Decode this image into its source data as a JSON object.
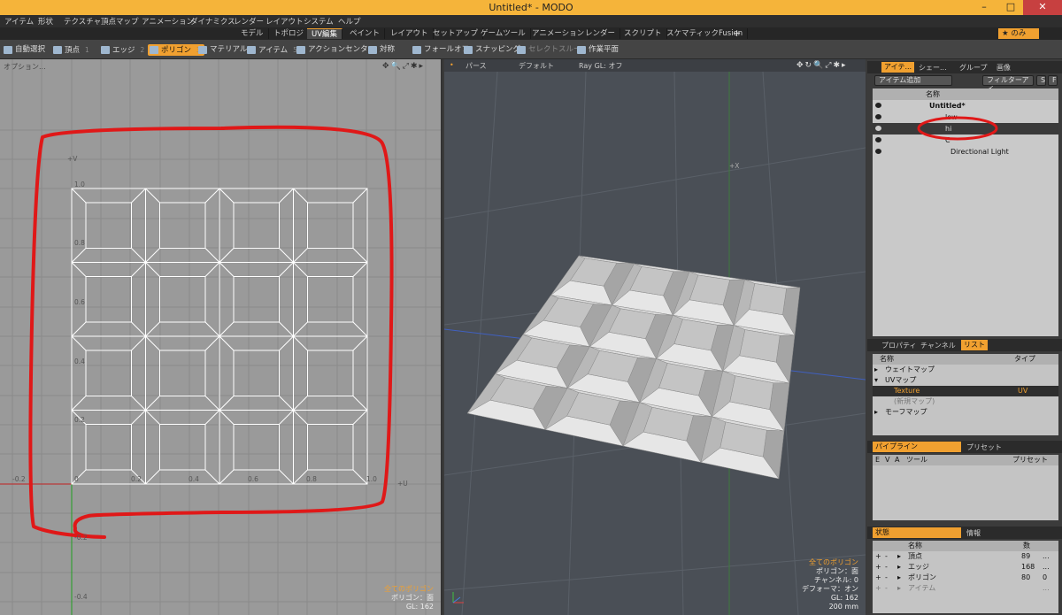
{
  "window": {
    "title": "Untitled* - MODO"
  },
  "menu": [
    "アイテム",
    "形状",
    "テクスチャ",
    "頂点マップ",
    "アニメーション",
    "ダイナミクス",
    "レンダー",
    "レイアウト",
    "システム",
    "ヘルプ"
  ],
  "tabs": [
    "モデル",
    "トポロジ",
    "UV編集",
    "ペイント",
    "レイアウト",
    "セットアップ",
    "ゲームツール",
    "アニメーション",
    "レンダー",
    "スクリプト",
    "スケマティックFusion"
  ],
  "active_tab": "UV編集",
  "tab_plus": "+",
  "layout_preset": "★ のみ",
  "toolbar": {
    "items": [
      {
        "label": "自動選択",
        "num": ""
      },
      {
        "label": "頂点",
        "num": "1"
      },
      {
        "label": "エッジ",
        "num": "2"
      },
      {
        "label": "ポリゴン",
        "num": "3"
      },
      {
        "label": "マテリアル",
        "num": ""
      },
      {
        "label": "アイテム",
        "num": "5"
      },
      {
        "label": "アクションセンター",
        "num": ""
      },
      {
        "label": "対称",
        "num": ""
      },
      {
        "label": "フォールオフ",
        "num": ""
      },
      {
        "label": "スナッピング",
        "num": ""
      },
      {
        "label": "セレクトスルー",
        "num": ""
      },
      {
        "label": "作業平面",
        "num": ""
      }
    ]
  },
  "uv_viewport": {
    "options_label": "オプション...",
    "axis_v": "+V",
    "axis_u": "+U",
    "v_ticks": [
      "1.0",
      "0.8",
      "0.6",
      "0.4",
      "0.2",
      "-0.2",
      "-0.4"
    ],
    "u_ticks": [
      "-0.2",
      "0",
      "0.2",
      "0.4",
      "0.6",
      "0.8",
      "1.0"
    ],
    "grid_cells": 4,
    "status": {
      "line1": "全てのポリゴン",
      "line2": "ポリゴン：面",
      "line3": "GL: 162"
    }
  },
  "view3d": {
    "header": [
      "パース",
      "デフォルト",
      "Ray GL: オフ"
    ],
    "axis_x": "+X",
    "status": {
      "line1": "全てのポリゴン",
      "line2": "ポリゴン：面",
      "line3": "チャンネル: 0",
      "line4": "デフォーマ：オン",
      "line5": "GL: 162",
      "line6": "200 mm"
    }
  },
  "items_panel": {
    "tabs": [
      "アイテ...",
      "シェー...",
      "グループ",
      "画像"
    ],
    "add_item": "アイテム追加",
    "filter": "フィルターアイ...",
    "s": "S",
    "f": "F",
    "col_name": "名称",
    "rows": [
      {
        "label": "Untitled*",
        "indent": 0,
        "selected": false
      },
      {
        "label": "low",
        "indent": 1,
        "selected": false
      },
      {
        "label": "hi",
        "indent": 1,
        "selected": true
      },
      {
        "label": "C",
        "indent": 1,
        "selected": false
      },
      {
        "label": "Directional Light",
        "indent": 1,
        "selected": false
      }
    ]
  },
  "list_panel": {
    "tabs": [
      "プロパティ",
      "チャンネル",
      "リスト"
    ],
    "col_name": "名称",
    "col_type": "タイプ",
    "rows": [
      {
        "label": "ウェイトマップ",
        "type": "",
        "style": ""
      },
      {
        "label": "UVマップ",
        "type": "",
        "style": ""
      },
      {
        "label": "Texture",
        "type": "UV",
        "style": "hi"
      },
      {
        "label": "(新規マップ)",
        "type": "",
        "style": "dim"
      },
      {
        "label": "モーフマップ",
        "type": "",
        "style": ""
      }
    ]
  },
  "pipeline_panel": {
    "tabs": [
      "パイプライン",
      "プリセット"
    ],
    "cols": [
      "E",
      "V",
      "A",
      "ツール",
      "プリセット"
    ]
  },
  "stats_panel": {
    "tabs": [
      "状態",
      "情報"
    ],
    "col_name": "名称",
    "col_count": "数",
    "rows": [
      {
        "label": "頂点",
        "count": "89",
        "extra": "..."
      },
      {
        "label": "エッジ",
        "count": "168",
        "extra": "..."
      },
      {
        "label": "ポリゴン",
        "count": "80",
        "extra": "0"
      },
      {
        "label": "アイテム",
        "count": "",
        "extra": "..."
      }
    ]
  },
  "colors": {
    "accent": "#f0a030",
    "annotation": "#e01818"
  }
}
